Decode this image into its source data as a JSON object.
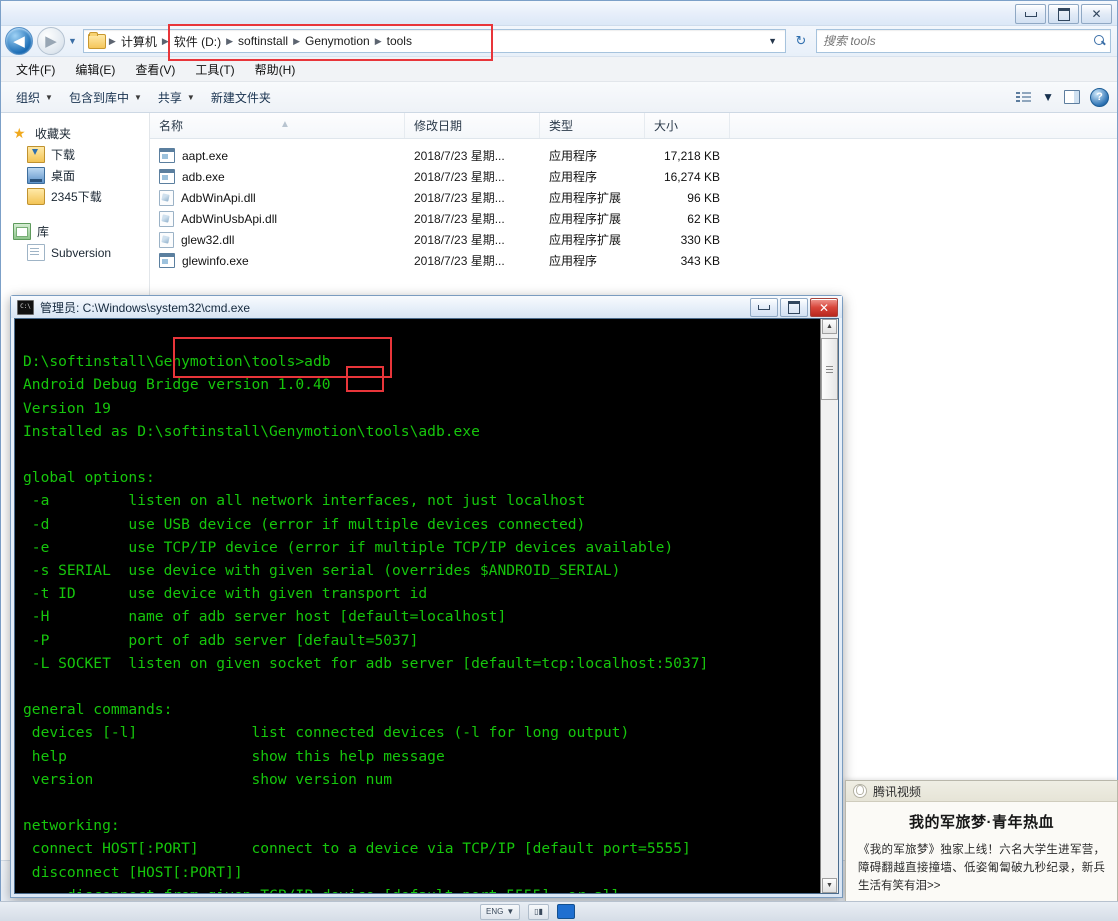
{
  "window": {
    "title_buttons": {
      "minimize": "—",
      "maximize": "❐",
      "close": "✕"
    }
  },
  "address_bar": {
    "back_label": "◀",
    "forward_label": "▶",
    "history_caret": "▼",
    "breadcrumb": [
      "计算机",
      "软件 (D:)",
      "softinstall",
      "Genymotion",
      "tools"
    ],
    "separator": "▶",
    "dropdown_caret": "▼",
    "refresh_label": "↻"
  },
  "search": {
    "placeholder": "搜索 tools",
    "value": ""
  },
  "menubar": {
    "items": [
      "文件(F)",
      "编辑(E)",
      "查看(V)",
      "工具(T)",
      "帮助(H)"
    ]
  },
  "commandbar": {
    "items": [
      {
        "label": "组织",
        "caret": "▼"
      },
      {
        "label": "包含到库中",
        "caret": "▼"
      },
      {
        "label": "共享",
        "caret": "▼"
      },
      {
        "label": "新建文件夹",
        "caret": ""
      }
    ],
    "view_caret": "▼",
    "help_glyph": "?"
  },
  "sidebar": {
    "groups": [
      {
        "header": {
          "label": "收藏夹",
          "icon": "star-icon"
        },
        "items": [
          {
            "label": "下载",
            "icon": "download-folder-icon"
          },
          {
            "label": "桌面",
            "icon": "desktop-icon"
          },
          {
            "label": "2345下载",
            "icon": "folder-icon"
          }
        ]
      },
      {
        "header": {
          "label": "库",
          "icon": "library-icon"
        },
        "items": [
          {
            "label": "Subversion",
            "icon": "document-icon"
          }
        ]
      }
    ]
  },
  "filelist": {
    "columns": [
      "名称",
      "修改日期",
      "类型",
      "大小"
    ],
    "sort_indicator": "▲",
    "rows": [
      {
        "name": "aapt.exe",
        "icon": "exe-icon",
        "date": "2018/7/23 星期...",
        "type": "应用程序",
        "size": "17,218 KB"
      },
      {
        "name": "adb.exe",
        "icon": "exe-icon",
        "date": "2018/7/23 星期...",
        "type": "应用程序",
        "size": "16,274 KB"
      },
      {
        "name": "AdbWinApi.dll",
        "icon": "dll-icon",
        "date": "2018/7/23 星期...",
        "type": "应用程序扩展",
        "size": "96 KB"
      },
      {
        "name": "AdbWinUsbApi.dll",
        "icon": "dll-icon",
        "date": "2018/7/23 星期...",
        "type": "应用程序扩展",
        "size": "62 KB"
      },
      {
        "name": "glew32.dll",
        "icon": "dll-icon",
        "date": "2018/7/23 星期...",
        "type": "应用程序扩展",
        "size": "330 KB"
      },
      {
        "name": "glewinfo.exe",
        "icon": "exe-icon",
        "date": "2018/7/23 星期...",
        "type": "应用程序",
        "size": "343 KB"
      }
    ]
  },
  "console": {
    "title": "管理员: C:\\Windows\\system32\\cmd.exe",
    "icon_label": "C:\\",
    "buttons": {
      "minimize": "—",
      "maximize": "❐",
      "close": "✕"
    },
    "text": "\nD:\\softinstall\\Genymotion\\tools>adb\nAndroid Debug Bridge version 1.0.40\nVersion 19\nInstalled as D:\\softinstall\\Genymotion\\tools\\adb.exe\n\nglobal options:\n -a         listen on all network interfaces, not just localhost\n -d         use USB device (error if multiple devices connected)\n -e         use TCP/IP device (error if multiple TCP/IP devices available)\n -s SERIAL  use device with given serial (overrides $ANDROID_SERIAL)\n -t ID      use device with given transport id\n -H         name of adb server host [default=localhost]\n -P         port of adb server [default=5037]\n -L SOCKET  listen on given socket for adb server [default=tcp:localhost:5037]\n\ngeneral commands:\n devices [-l]             list connected devices (-l for long output)\n help                     show this help message\n version                  show version num\n\nnetworking:\n connect HOST[:PORT]      connect to a device via TCP/IP [default port=5555]\n disconnect [HOST[:PORT]]\n     disconnect from given TCP/IP device [default port=5555], or all",
    "scroll": {
      "up_arrow": "▲",
      "down_arrow": "▼"
    }
  },
  "annotations": [
    {
      "name": "path-highlight",
      "target": "breadcrumb path tools"
    },
    {
      "name": "prompt-highlight",
      "target": "D:\\softinstall\\Genymotion\\tools>adb"
    },
    {
      "name": "version-highlight",
      "target": "40"
    }
  ],
  "tencent_popup": {
    "app_name": "腾讯视频",
    "headline": "我的军旅梦·青年热血",
    "body": "《我的军旅梦》独家上线！六名大学生进军营，障碍翻越直接撞墙、低姿匍匐破九秒纪录，新兵生活有笑有泪>>"
  },
  "taskbar": {
    "tray": [
      {
        "label": "ENG",
        "caret": "▼"
      },
      {
        "label": "▯▮",
        "caret": ""
      }
    ]
  },
  "colors": {
    "console_text": "#16c60c",
    "console_bg": "#000000",
    "annotation_red": "#e8353a",
    "accent_blue": "#2f74b5"
  }
}
